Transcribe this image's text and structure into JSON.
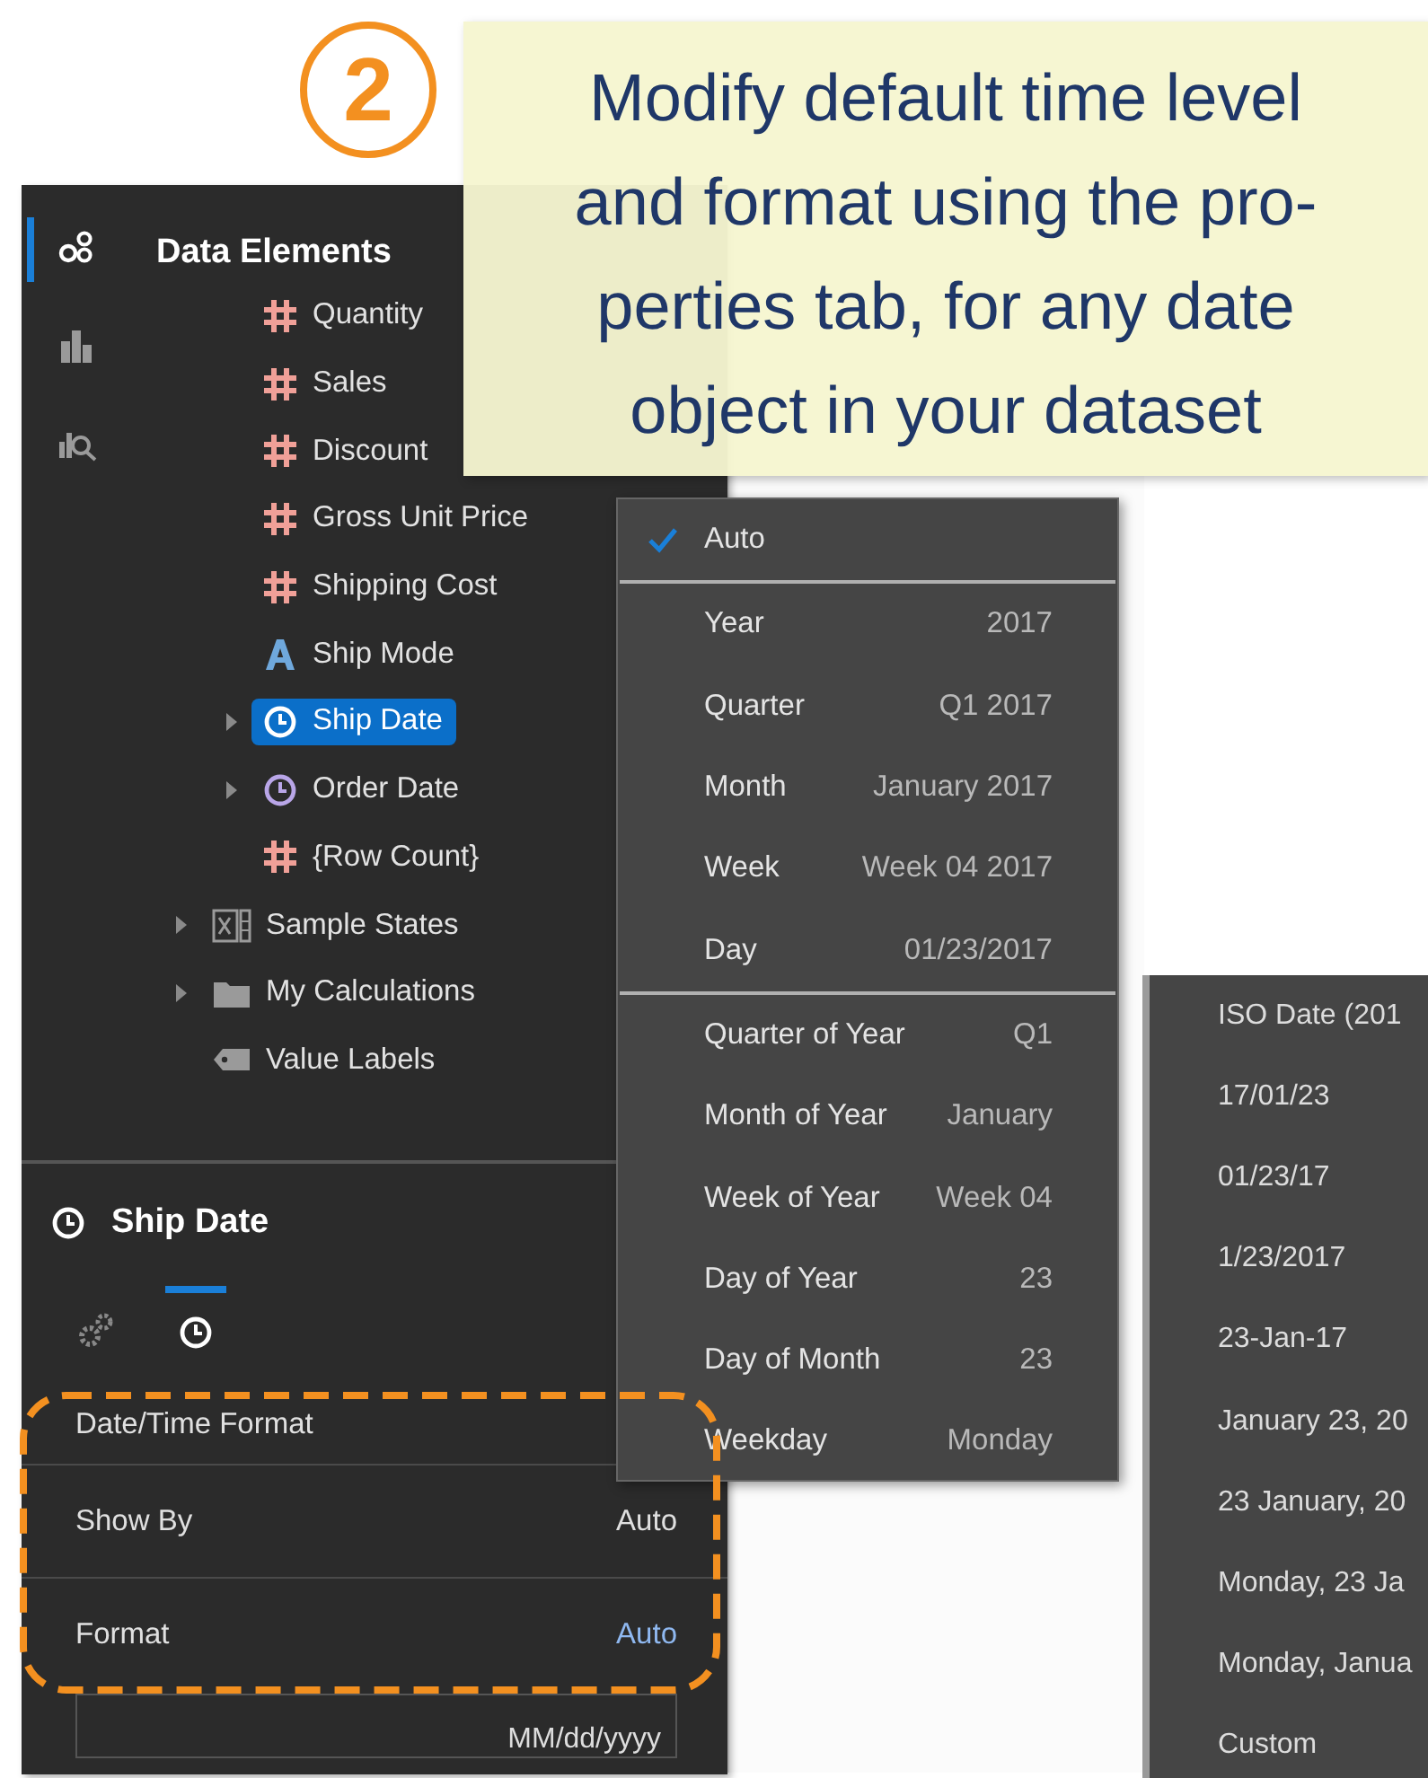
{
  "callout": {
    "step": "2",
    "text": "Modify default time level\nand format using the pro-\nperties tab, for any date\nobject in your dataset"
  },
  "panel": {
    "rail": [
      {
        "kind": "data",
        "selected": true
      },
      {
        "kind": "chart",
        "selected": false
      },
      {
        "kind": "explore",
        "selected": false
      }
    ],
    "title": "Data Elements",
    "tree": [
      {
        "children": [
          {
            "label": "Quantity",
            "kind": "measure",
            "selected": false
          },
          {
            "label": "Sales",
            "kind": "measure",
            "selected": false
          },
          {
            "label": "Discount",
            "kind": "measure",
            "selected": false
          },
          {
            "label": "Gross Unit Price",
            "kind": "measure",
            "selected": false
          },
          {
            "label": "Shipping Cost",
            "kind": "measure",
            "selected": false
          },
          {
            "label": "Ship Mode",
            "kind": "attribute",
            "selected": false
          },
          {
            "label": "Ship Date",
            "kind": "date",
            "selected": true,
            "expanded": false
          },
          {
            "label": "Order Date",
            "kind": "date",
            "selected": false,
            "expanded": false
          },
          {
            "label": "{Row Count}",
            "kind": "measure",
            "selected": false
          }
        ]
      },
      {
        "label": "Sample States",
        "kind": "dataset",
        "selected": false,
        "expanded": false
      },
      {
        "label": "My Calculations",
        "kind": "folder",
        "selected": false,
        "expanded": false
      },
      {
        "label": "Value Labels",
        "kind": "labels",
        "selected": false
      }
    ],
    "properties": {
      "title": "Ship Date",
      "tabs": [
        {
          "kind": "settings",
          "selected": false
        },
        {
          "kind": "time",
          "selected": true
        }
      ],
      "section": "Date/Time Format",
      "rows": [
        {
          "label": "Show By",
          "value": "Auto",
          "active": false
        },
        {
          "label": "Format",
          "value": "Auto",
          "active": true
        }
      ],
      "field": {
        "value": "MM/dd/yyyy"
      }
    }
  },
  "level_menu": {
    "sections": [
      [
        {
          "label": "Auto",
          "checked": true
        }
      ],
      [
        {
          "label": "Year",
          "example": "2017",
          "checked": false
        },
        {
          "label": "Quarter",
          "example": "Q1 2017",
          "checked": false
        },
        {
          "label": "Month",
          "example": "January 2017",
          "checked": false
        },
        {
          "label": "Week",
          "example": "Week 04 2017",
          "checked": false
        },
        {
          "label": "Day",
          "example": "01/23/2017",
          "checked": false
        }
      ],
      [
        {
          "label": "Quarter of Year",
          "example": "Q1",
          "checked": false
        },
        {
          "label": "Month of Year",
          "example": "January",
          "checked": false
        },
        {
          "label": "Week of Year",
          "example": "Week 04",
          "checked": false
        },
        {
          "label": "Day of Year",
          "example": "23",
          "checked": false
        },
        {
          "label": "Day of Month",
          "example": "23",
          "checked": false
        },
        {
          "label": "Weekday",
          "example": "Monday",
          "checked": false
        }
      ]
    ]
  },
  "format_menu": {
    "items": [
      "ISO Date (201",
      "17/01/23",
      "01/23/17",
      "1/23/2017",
      "23-Jan-17",
      "January 23, 20",
      "23 January, 20",
      "Monday, 23 Ja",
      "Monday, Janua",
      "Custom"
    ]
  }
}
